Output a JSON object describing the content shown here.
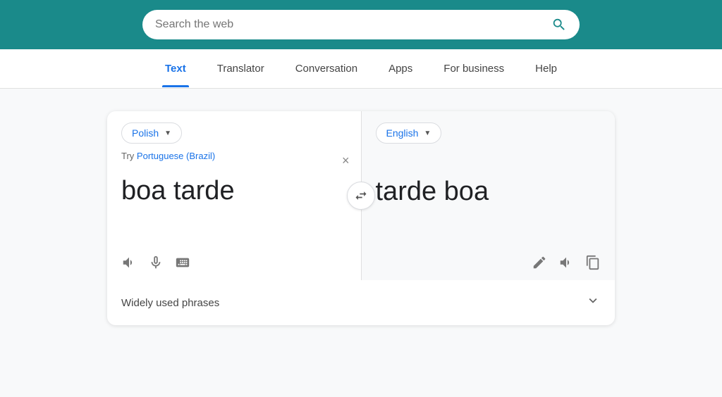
{
  "header": {
    "search_placeholder": "Search the web",
    "background_color": "#1a8a8a"
  },
  "nav": {
    "items": [
      {
        "label": "Text",
        "active": true
      },
      {
        "label": "Translator",
        "active": false
      },
      {
        "label": "Conversation",
        "active": false
      },
      {
        "label": "Apps",
        "active": false
      },
      {
        "label": "For business",
        "active": false
      },
      {
        "label": "Help",
        "active": false
      }
    ]
  },
  "translator": {
    "source_language": "Polish",
    "target_language": "English",
    "source_text": "boa tarde",
    "target_text": "tarde boa",
    "try_label": "Try",
    "try_suggestion": "Portuguese (Brazil)",
    "clear_symbol": "×",
    "swap_symbol": "⇄"
  },
  "icons": {
    "volume_source": "🔊",
    "mic": "🎤",
    "keyboard": "⌨",
    "volume_target": "🔊",
    "pencil": "✏",
    "copy": "⧉",
    "chevron": "∨",
    "search": "search"
  },
  "phrases": {
    "label": "Widely used phrases"
  }
}
